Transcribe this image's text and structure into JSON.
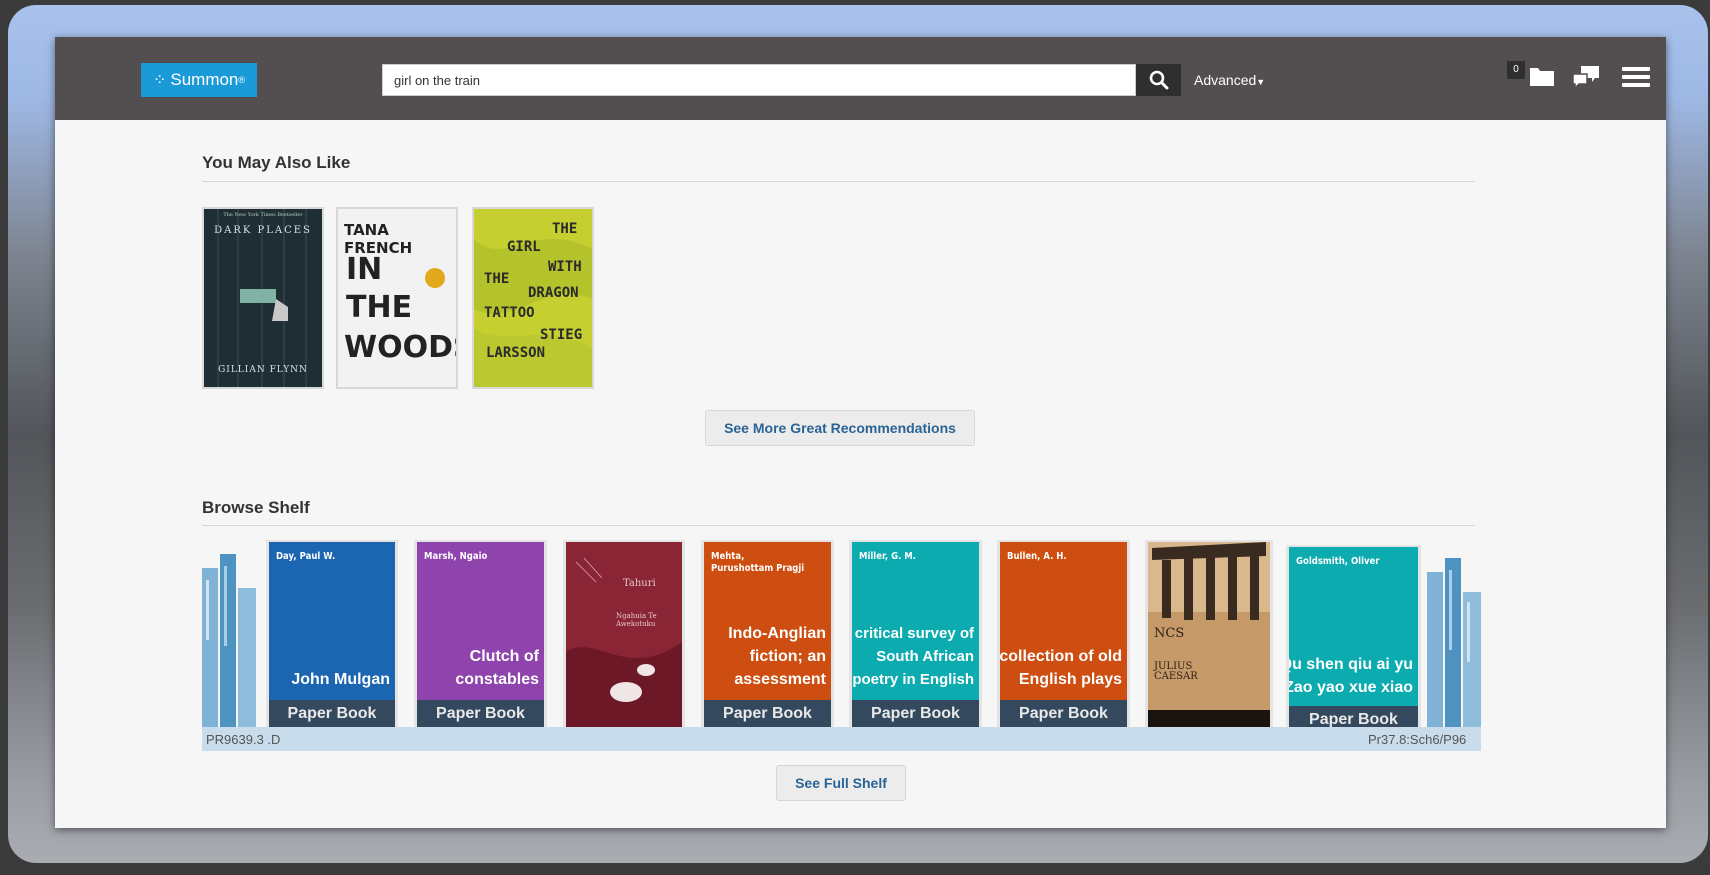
{
  "header": {
    "logo_text": "Summon",
    "logo_reg": "®",
    "search_value": "girl on the train",
    "advanced_label": "Advanced",
    "saved_count": "0"
  },
  "recommendations": {
    "title": "You May Also Like",
    "covers": [
      {
        "top": "The New York Times Bestseller",
        "title": "DARK PLACES",
        "author": "GILLIAN FLYNN"
      },
      {
        "title_lines": [
          "TANA FRENCH",
          "IN",
          "THE",
          "WOODS"
        ]
      },
      {
        "title_lines": [
          "THE",
          "GIRL",
          "WITH",
          "THE",
          "DRAGON",
          "TATTOO",
          "STIEG",
          "LARSSON"
        ]
      }
    ],
    "more_button": "See More Great Recommendations"
  },
  "shelf": {
    "title": "Browse Shelf",
    "books": [
      {
        "author": "Day, Paul W.",
        "title": "John Mulgan",
        "format": "Paper Book",
        "color": "#1c65b0"
      },
      {
        "author": "Marsh, Ngaio",
        "title": "Clutch of constables",
        "format": "Paper Book",
        "color": "#8f44ad"
      },
      {
        "cover_text": "Tahuri",
        "cover_author": "Ngahuia Te Awekotuku"
      },
      {
        "author": "Mehta, Purushottam Pragji",
        "title": "Indo-Anglian fiction; an assessment",
        "format": "Paper Book",
        "color": "#cd4e10"
      },
      {
        "author": "Miller, G. M.",
        "title": "A critical survey of South African poetry in English",
        "format": "Paper Book",
        "color": "#0cabb0"
      },
      {
        "author": "Bullen, A. H.",
        "title": "A collection of old English plays",
        "format": "Paper Book",
        "color": "#cd4e10"
      },
      {
        "cover_series": "NCS",
        "cover_title": "JULIUS CAESAR"
      },
      {
        "author": "Goldsmith, Oliver",
        "title": "Qu shen qiu ai yu Zao yao xue xiao",
        "format": "Paper Book",
        "color": "#0cabb0"
      }
    ],
    "call_start": "PR9639.3 .D",
    "call_end": "Pr37.8:Sch6/P96",
    "full_button": "See Full Shelf"
  }
}
